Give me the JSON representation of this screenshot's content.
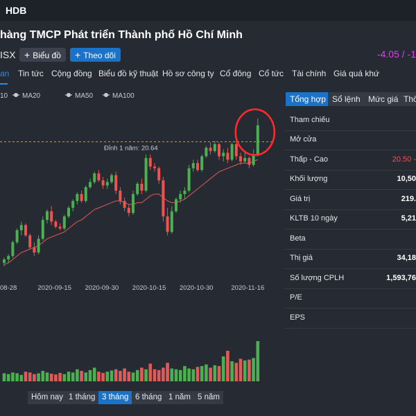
{
  "header": {
    "ticker": "HDB"
  },
  "stock": {
    "company_name": "hàng TMCP Phát triển Thành phố Hồ Chí Minh",
    "exchange": "ISX",
    "chart_button_label": "Biểu đồ",
    "follow_button_label": "Theo dõi",
    "change": "-4.05 / -1"
  },
  "nav": {
    "tabs": [
      "an",
      "Tin tức",
      "Cộng đồng",
      "Biểu đồ kỹ thuật",
      "Hồ sơ công ty",
      "Cổ đông",
      "Cổ tức",
      "Tài chính",
      "Giá quá khứ"
    ]
  },
  "chart": {
    "legend": [
      "10",
      "MA20",
      "MA50",
      "MA100"
    ],
    "annotation": "Đỉnh 1 năm: 20.64",
    "x_ticks": [
      "08-28",
      "2020-09-15",
      "2020-09-30",
      "2020-10-15",
      "2020-10-30",
      "2020-11-16"
    ],
    "colors": {
      "up": "#4caf50",
      "down": "#ef5350",
      "ma": "#d9534f",
      "volume_up": "#4caf50",
      "volume_down": "#e05a5a",
      "highlight": "#ff2a2a"
    }
  },
  "chart_data": {
    "type": "candlestick",
    "title": "",
    "xlabel": "",
    "ylabel": "",
    "ylim": [
      13.0,
      23.0
    ],
    "reference_line": 20.64,
    "x": [
      "08-28",
      "2020-09-15",
      "2020-09-30",
      "2020-10-15",
      "2020-10-30",
      "2020-11-16"
    ],
    "x_positions": [
      0,
      12,
      23,
      34,
      45,
      57
    ],
    "candles": [
      {
        "o": 13.6,
        "h": 13.9,
        "l": 13.4,
        "c": 13.8
      },
      {
        "o": 13.8,
        "h": 14.1,
        "l": 13.6,
        "c": 14.0
      },
      {
        "o": 14.0,
        "h": 14.9,
        "l": 13.9,
        "c": 14.8
      },
      {
        "o": 14.8,
        "h": 15.6,
        "l": 14.7,
        "c": 15.5
      },
      {
        "o": 15.5,
        "h": 16.0,
        "l": 15.2,
        "c": 15.8
      },
      {
        "o": 15.8,
        "h": 15.9,
        "l": 15.1,
        "c": 15.2
      },
      {
        "o": 15.2,
        "h": 15.3,
        "l": 14.4,
        "c": 14.5
      },
      {
        "o": 14.5,
        "h": 14.8,
        "l": 14.0,
        "c": 14.2
      },
      {
        "o": 14.2,
        "h": 15.2,
        "l": 14.1,
        "c": 15.0
      },
      {
        "o": 15.0,
        "h": 16.3,
        "l": 14.9,
        "c": 16.1
      },
      {
        "o": 16.1,
        "h": 16.7,
        "l": 15.9,
        "c": 16.6
      },
      {
        "o": 16.6,
        "h": 16.9,
        "l": 15.8,
        "c": 16.0
      },
      {
        "o": 16.0,
        "h": 16.1,
        "l": 15.6,
        "c": 15.7
      },
      {
        "o": 15.7,
        "h": 15.9,
        "l": 15.5,
        "c": 15.6
      },
      {
        "o": 15.6,
        "h": 16.4,
        "l": 15.5,
        "c": 16.3
      },
      {
        "o": 16.3,
        "h": 16.9,
        "l": 16.2,
        "c": 16.8
      },
      {
        "o": 16.8,
        "h": 17.3,
        "l": 16.6,
        "c": 17.2
      },
      {
        "o": 17.2,
        "h": 17.7,
        "l": 17.0,
        "c": 17.6
      },
      {
        "o": 17.6,
        "h": 17.8,
        "l": 17.1,
        "c": 17.2
      },
      {
        "o": 17.2,
        "h": 18.1,
        "l": 17.1,
        "c": 18.0
      },
      {
        "o": 18.0,
        "h": 18.5,
        "l": 17.9,
        "c": 18.3
      },
      {
        "o": 18.3,
        "h": 18.9,
        "l": 18.2,
        "c": 18.8
      },
      {
        "o": 18.8,
        "h": 19.0,
        "l": 18.3,
        "c": 18.4
      },
      {
        "o": 18.4,
        "h": 18.6,
        "l": 17.9,
        "c": 18.1
      },
      {
        "o": 18.1,
        "h": 18.5,
        "l": 17.9,
        "c": 18.3
      },
      {
        "o": 18.3,
        "h": 18.8,
        "l": 18.2,
        "c": 18.7
      },
      {
        "o": 18.7,
        "h": 18.9,
        "l": 17.6,
        "c": 17.8
      },
      {
        "o": 17.8,
        "h": 18.0,
        "l": 17.0,
        "c": 17.2
      },
      {
        "o": 17.2,
        "h": 17.4,
        "l": 16.6,
        "c": 16.8
      },
      {
        "o": 16.8,
        "h": 17.0,
        "l": 16.3,
        "c": 16.5
      },
      {
        "o": 16.5,
        "h": 17.8,
        "l": 16.4,
        "c": 17.6
      },
      {
        "o": 17.6,
        "h": 18.3,
        "l": 17.5,
        "c": 18.2
      },
      {
        "o": 18.2,
        "h": 18.5,
        "l": 17.6,
        "c": 17.8
      },
      {
        "o": 17.8,
        "h": 19.9,
        "l": 17.7,
        "c": 19.7
      },
      {
        "o": 19.7,
        "h": 19.9,
        "l": 19.0,
        "c": 19.2
      },
      {
        "o": 19.2,
        "h": 19.4,
        "l": 18.9,
        "c": 19.1
      },
      {
        "o": 19.1,
        "h": 19.2,
        "l": 18.2,
        "c": 18.4
      },
      {
        "o": 18.4,
        "h": 18.6,
        "l": 16.0,
        "c": 16.3
      },
      {
        "o": 16.3,
        "h": 16.8,
        "l": 15.2,
        "c": 15.4
      },
      {
        "o": 15.4,
        "h": 16.9,
        "l": 15.3,
        "c": 16.6
      },
      {
        "o": 16.6,
        "h": 17.4,
        "l": 16.5,
        "c": 17.3
      },
      {
        "o": 17.3,
        "h": 17.8,
        "l": 17.1,
        "c": 17.6
      },
      {
        "o": 17.6,
        "h": 18.0,
        "l": 17.3,
        "c": 17.8
      },
      {
        "o": 17.8,
        "h": 19.3,
        "l": 17.7,
        "c": 19.1
      },
      {
        "o": 19.1,
        "h": 19.6,
        "l": 18.9,
        "c": 19.4
      },
      {
        "o": 19.4,
        "h": 19.6,
        "l": 18.9,
        "c": 19.0
      },
      {
        "o": 19.0,
        "h": 19.9,
        "l": 18.9,
        "c": 19.8
      },
      {
        "o": 19.8,
        "h": 20.4,
        "l": 19.7,
        "c": 20.3
      },
      {
        "o": 20.3,
        "h": 20.6,
        "l": 19.9,
        "c": 20.1
      },
      {
        "o": 20.1,
        "h": 20.7,
        "l": 20.0,
        "c": 20.5
      },
      {
        "o": 20.5,
        "h": 20.6,
        "l": 19.6,
        "c": 19.8
      },
      {
        "o": 19.8,
        "h": 20.2,
        "l": 19.5,
        "c": 20.0
      },
      {
        "o": 20.0,
        "h": 20.3,
        "l": 19.4,
        "c": 19.6
      },
      {
        "o": 19.6,
        "h": 20.6,
        "l": 19.5,
        "c": 20.5
      },
      {
        "o": 20.5,
        "h": 20.7,
        "l": 19.6,
        "c": 19.8
      },
      {
        "o": 19.8,
        "h": 20.0,
        "l": 19.3,
        "c": 19.5
      },
      {
        "o": 19.5,
        "h": 20.0,
        "l": 19.4,
        "c": 19.7
      },
      {
        "o": 19.7,
        "h": 19.8,
        "l": 19.1,
        "c": 19.3
      },
      {
        "o": 19.3,
        "h": 20.2,
        "l": 19.2,
        "c": 19.9
      },
      {
        "o": 19.9,
        "h": 22.0,
        "l": 19.8,
        "c": 21.6
      }
    ],
    "ma": [
      13.5,
      13.6,
      13.8,
      14.0,
      14.2,
      14.3,
      14.4,
      14.5,
      14.6,
      14.8,
      15.0,
      15.1,
      15.2,
      15.3,
      15.4,
      15.6,
      15.8,
      16.0,
      16.1,
      16.3,
      16.5,
      16.7,
      16.8,
      16.9,
      17.0,
      17.1,
      17.2,
      17.2,
      17.1,
      17.0,
      17.0,
      17.1,
      17.1,
      17.3,
      17.5,
      17.6,
      17.6,
      17.4,
      17.2,
      17.1,
      17.1,
      17.2,
      17.3,
      17.5,
      17.7,
      17.9,
      18.1,
      18.3,
      18.5,
      18.7,
      18.9,
      19.0,
      19.1,
      19.2,
      19.3,
      19.4,
      19.4,
      19.4,
      19.5,
      19.6
    ],
    "volume": [
      0.2,
      0.18,
      0.22,
      0.2,
      0.16,
      0.24,
      0.22,
      0.18,
      0.2,
      0.26,
      0.22,
      0.19,
      0.17,
      0.21,
      0.18,
      0.24,
      0.22,
      0.3,
      0.26,
      0.22,
      0.28,
      0.34,
      0.24,
      0.21,
      0.24,
      0.27,
      0.3,
      0.26,
      0.32,
      0.24,
      0.22,
      0.28,
      0.34,
      0.3,
      0.44,
      0.3,
      0.28,
      0.34,
      0.46,
      0.32,
      0.3,
      0.28,
      0.38,
      0.32,
      0.3,
      0.36,
      0.38,
      0.42,
      0.34,
      0.4,
      0.38,
      0.62,
      0.76,
      0.5,
      0.46,
      0.56,
      0.52,
      0.54,
      0.58,
      1.0
    ]
  },
  "right_panel": {
    "tabs": [
      "Tổng hợp",
      "Sổ lệnh",
      "Mức giá",
      "Thố"
    ],
    "rows": [
      {
        "label": "Tham chiếu",
        "value": "",
        "color": "#ffffff"
      },
      {
        "label": "Mở cửa",
        "value": "",
        "color": "#ffffff"
      },
      {
        "label": "Thấp - Cao",
        "value": "20.50  -",
        "color": "#ef5350"
      },
      {
        "label": "Khối lượng",
        "value": "10,50",
        "color": "#ffffff"
      },
      {
        "label": "Giá trị",
        "value": "219.",
        "color": "#ffffff"
      },
      {
        "label": "KLTB 10 ngày",
        "value": "5,21",
        "color": "#ffffff"
      },
      {
        "label": "Beta",
        "value": "",
        "color": "#ffffff"
      },
      {
        "label": "Thị giá",
        "value": "34,18",
        "color": "#ffffff"
      },
      {
        "label": "Số lượng CPLH",
        "value": "1,593,76",
        "color": "#ffffff"
      },
      {
        "label": "P/E",
        "value": "",
        "color": "#ffffff"
      },
      {
        "label": "EPS",
        "value": "",
        "color": "#ffffff"
      }
    ]
  },
  "range": {
    "tabs": [
      "Hôm nay",
      "1 tháng",
      "3 tháng",
      "6 tháng",
      "1 năm",
      "5 năm"
    ],
    "active": "3 tháng"
  }
}
